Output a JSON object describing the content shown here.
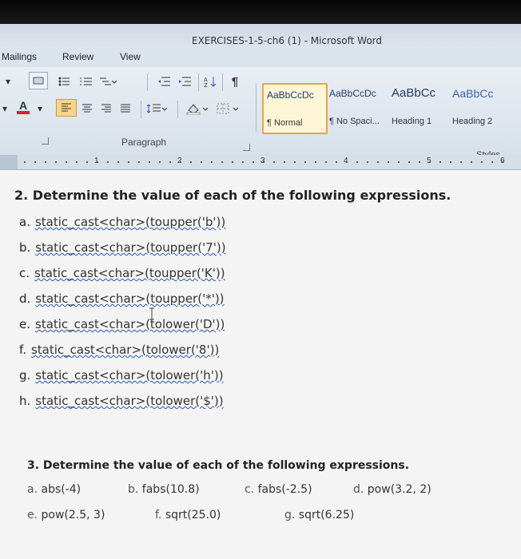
{
  "window": {
    "title": "EXERCISES-1-5-ch6 (1) - Microsoft Word"
  },
  "ribbon_tabs": [
    "Mailings",
    "Review",
    "View"
  ],
  "ribbon": {
    "paragraph_group_label": "Paragraph",
    "styles_group_label": "Styles",
    "styles": [
      {
        "sample": "AaBbCcDc",
        "name": "¶ Normal",
        "selected": true
      },
      {
        "sample": "AaBbCcDc",
        "name": "¶ No Spaci..."
      },
      {
        "sample": "AaBbCc",
        "name": "Heading 1"
      },
      {
        "sample": "AaBbCc",
        "name": "Heading 2"
      }
    ]
  },
  "ruler": {
    "numbers": [
      "1",
      "2",
      "3",
      "4",
      "5",
      "6"
    ]
  },
  "document": {
    "q2_heading": "2. Determine the value of each of the following expressions.",
    "q2_items": [
      {
        "letter": "a.",
        "expr": "static_cast<char>(toupper('b'))"
      },
      {
        "letter": "b.",
        "expr": "static_cast<char>(toupper('7'))"
      },
      {
        "letter": "c.",
        "expr": "static_cast<char>(toupper('K'))"
      },
      {
        "letter": "d.",
        "expr": "static_cast<char>(toupper('*'))"
      },
      {
        "letter": "e.",
        "expr": "static_cast<char>(tolower('D'))"
      },
      {
        "letter": "f.",
        "expr": "static_cast<char>(tolower('8'))"
      },
      {
        "letter": "g.",
        "expr": "static_cast<char>(tolower('h'))"
      },
      {
        "letter": "h.",
        "expr": "static_cast<char>(tolower('$'))"
      }
    ],
    "q3_heading": "3. Determine the value of each of the following expressions.",
    "q3_row1": [
      {
        "letter": "a.",
        "expr": "abs(-4)"
      },
      {
        "letter": "b.",
        "expr": "fabs(10.8)"
      },
      {
        "letter": "c.",
        "expr": "fabs(-2.5)"
      },
      {
        "letter": "d.",
        "expr": "pow(3.2, 2)"
      }
    ],
    "q3_row2": [
      {
        "letter": "e.",
        "expr": "pow(2.5, 3)"
      },
      {
        "letter": "f.",
        "expr": "sqrt(25.0)"
      },
      {
        "letter": "g.",
        "expr": "sqrt(6.25)"
      }
    ]
  }
}
